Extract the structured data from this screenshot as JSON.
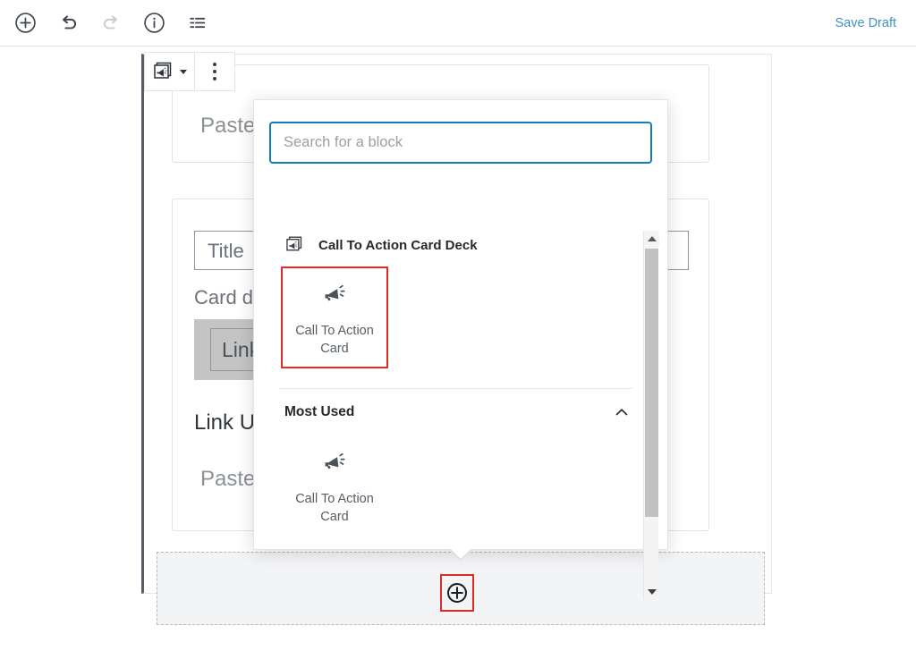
{
  "toolbar": {
    "icons": [
      {
        "name": "add-block-icon",
        "label": "Add block"
      },
      {
        "name": "undo-icon",
        "label": "Undo"
      },
      {
        "name": "redo-icon",
        "label": "Redo"
      },
      {
        "name": "info-icon",
        "label": "Content structure"
      },
      {
        "name": "list-view-icon",
        "label": "Block navigation"
      }
    ],
    "save_draft_label": "Save Draft",
    "save_draft_color": "#3e93c4"
  },
  "block_toolbar": {
    "block_type_icon": "call-to-action-card-deck-icon",
    "more_options_icon": "more-vertical-icon"
  },
  "editor": {
    "paste_text_top": "Paste",
    "title_placeholder": "Title",
    "card_description_label": "Card d",
    "link_button_label": "Link",
    "link_url_heading": "Link Ul",
    "paste_text_bottom": "Paste"
  },
  "appender": {
    "add_icon": "plus-circle-icon",
    "highlight_color": "#e02b2b"
  },
  "inserter": {
    "search": {
      "placeholder": "Search for a block",
      "value": "",
      "focus_color": "#127fb4"
    },
    "sections": [
      {
        "id": "current-block",
        "title": "Call To Action Card Deck",
        "icon": "call-to-action-card-deck-icon",
        "collapsible": false,
        "items": [
          {
            "label": "Call To Action Card",
            "icon": "megaphone-icon",
            "highlighted": true
          }
        ]
      },
      {
        "id": "most-used",
        "title": "Most Used",
        "collapsible": true,
        "chevron": "chevron-up-icon",
        "items": [
          {
            "label": "Call To Action Card",
            "icon": "megaphone-icon",
            "highlighted": false
          }
        ]
      }
    ],
    "scrollbar": {
      "up_icon": "scroll-up-arrow-icon",
      "down_icon": "scroll-down-arrow-icon"
    }
  }
}
